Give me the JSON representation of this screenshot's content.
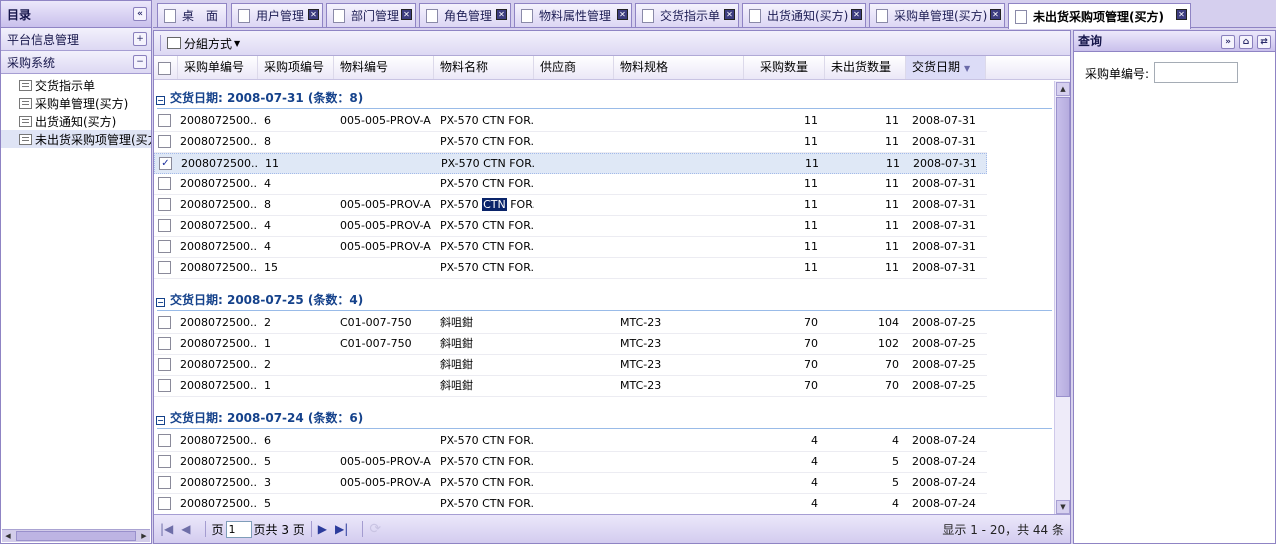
{
  "left_panel": {
    "title": "目录",
    "sections": [
      {
        "label": "平台信息管理",
        "toggle": "+"
      },
      {
        "label": "采购系统",
        "toggle": "−"
      }
    ],
    "tree_items": [
      "交货指示单",
      "采购单管理(买方)",
      "出货通知(买方)",
      "未出货采购项管理(买方)"
    ]
  },
  "tabs": [
    {
      "label": "桌　面"
    },
    {
      "label": "用户管理"
    },
    {
      "label": "部门管理"
    },
    {
      "label": "角色管理"
    },
    {
      "label": "物料属性管理"
    },
    {
      "label": "交货指示单"
    },
    {
      "label": "出货通知(买方)"
    },
    {
      "label": "采购单管理(买方)"
    },
    {
      "label": "未出货采购项管理(买方)",
      "active": true
    }
  ],
  "grid": {
    "toolbar": {
      "group_label": "分組方式"
    },
    "columns": [
      "采购单编号",
      "采购项编号",
      "物料编号",
      "物料名称",
      "供应商",
      "物料规格",
      "采购数量",
      "未出货数量",
      "交货日期"
    ],
    "groups": [
      {
        "label": "交货日期: 2008-07-31 (条数：8)",
        "rows": [
          {
            "po": "2008072500...",
            "item": "6",
            "mat": "005-005-PROV-A",
            "name": "PX-570 CTN FOR...",
            "supplier": "",
            "spec": "",
            "qty": "11",
            "pending": "11",
            "date": "2008-07-31"
          },
          {
            "po": "2008072500...",
            "item": "8",
            "mat": "",
            "name": "PX-570 CTN FOR...",
            "supplier": "",
            "spec": "",
            "qty": "11",
            "pending": "11",
            "date": "2008-07-31"
          },
          {
            "po": "2008072500...",
            "item": "11",
            "mat": "",
            "name": "PX-570 CTN FOR...",
            "supplier": "",
            "spec": "",
            "qty": "11",
            "pending": "11",
            "date": "2008-07-31",
            "selected": true
          },
          {
            "po": "2008072500...",
            "item": "4",
            "mat": "",
            "name": "PX-570 CTN FOR...",
            "supplier": "",
            "spec": "",
            "qty": "11",
            "pending": "11",
            "date": "2008-07-31"
          },
          {
            "po": "2008072500...",
            "item": "8",
            "mat": "005-005-PROV-A",
            "name_pre": "PX-570 ",
            "name_hl": "CTN",
            "name_post": " FOR...",
            "supplier": "",
            "spec": "",
            "qty": "11",
            "pending": "11",
            "date": "2008-07-31"
          },
          {
            "po": "2008072500...",
            "item": "4",
            "mat": "005-005-PROV-A",
            "name": "PX-570 CTN FOR...",
            "supplier": "",
            "spec": "",
            "qty": "11",
            "pending": "11",
            "date": "2008-07-31"
          },
          {
            "po": "2008072500...",
            "item": "4",
            "mat": "005-005-PROV-A",
            "name": "PX-570 CTN FOR...",
            "supplier": "",
            "spec": "",
            "qty": "11",
            "pending": "11",
            "date": "2008-07-31"
          },
          {
            "po": "2008072500...",
            "item": "15",
            "mat": "",
            "name": "PX-570 CTN FOR...",
            "supplier": "",
            "spec": "",
            "qty": "11",
            "pending": "11",
            "date": "2008-07-31"
          }
        ]
      },
      {
        "label": "交货日期: 2008-07-25 (条数：4)",
        "rows": [
          {
            "po": "2008072500...",
            "item": "2",
            "mat": "C01-007-750",
            "name": "斜咀鉗",
            "supplier": "",
            "spec": "MTC-23",
            "qty": "70",
            "pending": "104",
            "date": "2008-07-25"
          },
          {
            "po": "2008072500...",
            "item": "1",
            "mat": "C01-007-750",
            "name": "斜咀鉗",
            "supplier": "",
            "spec": "MTC-23",
            "qty": "70",
            "pending": "102",
            "date": "2008-07-25"
          },
          {
            "po": "2008072500...",
            "item": "2",
            "mat": "",
            "name": "斜咀鉗",
            "supplier": "",
            "spec": "MTC-23",
            "qty": "70",
            "pending": "70",
            "date": "2008-07-25"
          },
          {
            "po": "2008072500...",
            "item": "1",
            "mat": "",
            "name": "斜咀鉗",
            "supplier": "",
            "spec": "MTC-23",
            "qty": "70",
            "pending": "70",
            "date": "2008-07-25"
          }
        ]
      },
      {
        "label": "交货日期: 2008-07-24 (条数：6)",
        "rows": [
          {
            "po": "2008072500...",
            "item": "6",
            "mat": "",
            "name": "PX-570 CTN FOR...",
            "supplier": "",
            "spec": "",
            "qty": "4",
            "pending": "4",
            "date": "2008-07-24"
          },
          {
            "po": "2008072500...",
            "item": "5",
            "mat": "005-005-PROV-A",
            "name": "PX-570 CTN FOR...",
            "supplier": "",
            "spec": "",
            "qty": "4",
            "pending": "5",
            "date": "2008-07-24"
          },
          {
            "po": "2008072500...",
            "item": "3",
            "mat": "005-005-PROV-A",
            "name": "PX-570 CTN FOR...",
            "supplier": "",
            "spec": "",
            "qty": "4",
            "pending": "5",
            "date": "2008-07-24"
          },
          {
            "po": "2008072500...",
            "item": "5",
            "mat": "",
            "name": "PX-570 CTN FOR...",
            "supplier": "",
            "spec": "",
            "qty": "4",
            "pending": "4",
            "date": "2008-07-24"
          }
        ]
      }
    ],
    "paging": {
      "page_label": "页",
      "page_value": "1",
      "total_label": "页共 3 页",
      "display_info": "显示 1 - 20，共 44 条"
    }
  },
  "query_panel": {
    "title": "查询",
    "field_label": "采购单编号:",
    "field_value": ""
  },
  "colors": {
    "panel_border": "#8f84c4",
    "header_bg": "#c9c0ec",
    "group_text": "#15428b",
    "selected_row": "#dfe8f6"
  }
}
